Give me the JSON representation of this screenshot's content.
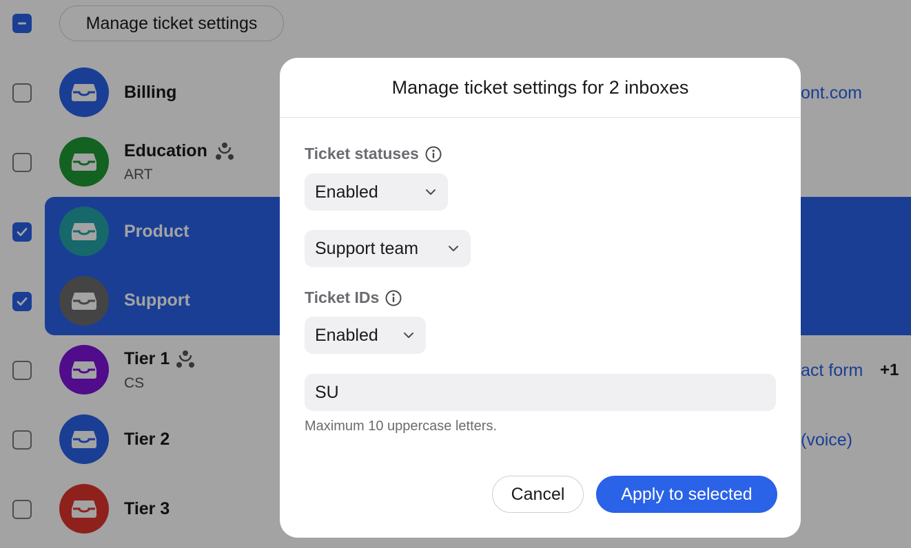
{
  "header": {
    "bulk_button_label": "Manage ticket settings",
    "select_all_state": "indeterminate"
  },
  "inboxes": [
    {
      "name": "Billing",
      "subtitle": "",
      "color": "#2a62e8",
      "selected": false,
      "shared": false,
      "channel": "ont.com"
    },
    {
      "name": "Education",
      "subtitle": "ART",
      "color": "#1f9a35",
      "selected": false,
      "shared": true,
      "channel": ""
    },
    {
      "name": "Product",
      "subtitle": "",
      "color": "#25a3a6",
      "selected": true,
      "shared": false,
      "channel": ""
    },
    {
      "name": "Support",
      "subtitle": "",
      "color": "#6b6b6b",
      "selected": true,
      "shared": false,
      "channel": ""
    },
    {
      "name": "Tier 1",
      "subtitle": "CS",
      "color": "#7d14d9",
      "selected": false,
      "shared": true,
      "channel": "act form",
      "extra_count": "+1"
    },
    {
      "name": "Tier 2",
      "subtitle": "",
      "color": "#2a62e8",
      "selected": false,
      "shared": false,
      "channel": "(voice)"
    },
    {
      "name": "Tier 3",
      "subtitle": "",
      "color": "#e0342e",
      "selected": false,
      "shared": false,
      "channel": ""
    }
  ],
  "modal": {
    "title": "Manage ticket settings for 2 inboxes",
    "ticket_statuses": {
      "label": "Ticket statuses",
      "value": "Enabled",
      "team_value": "Support team"
    },
    "ticket_ids": {
      "label": "Ticket IDs",
      "value": "Enabled",
      "prefix_value": "SU",
      "hint": "Maximum 10 uppercase letters."
    },
    "cancel_label": "Cancel",
    "apply_label": "Apply to selected"
  },
  "colors": {
    "accent": "#2a62e8",
    "overlay": "rgba(0,0,0,0.36)"
  },
  "icons": [
    "inbox-icon",
    "shared-inbox-icon",
    "info-icon",
    "chevron-down-icon",
    "checkmark-icon",
    "minus-icon"
  ]
}
